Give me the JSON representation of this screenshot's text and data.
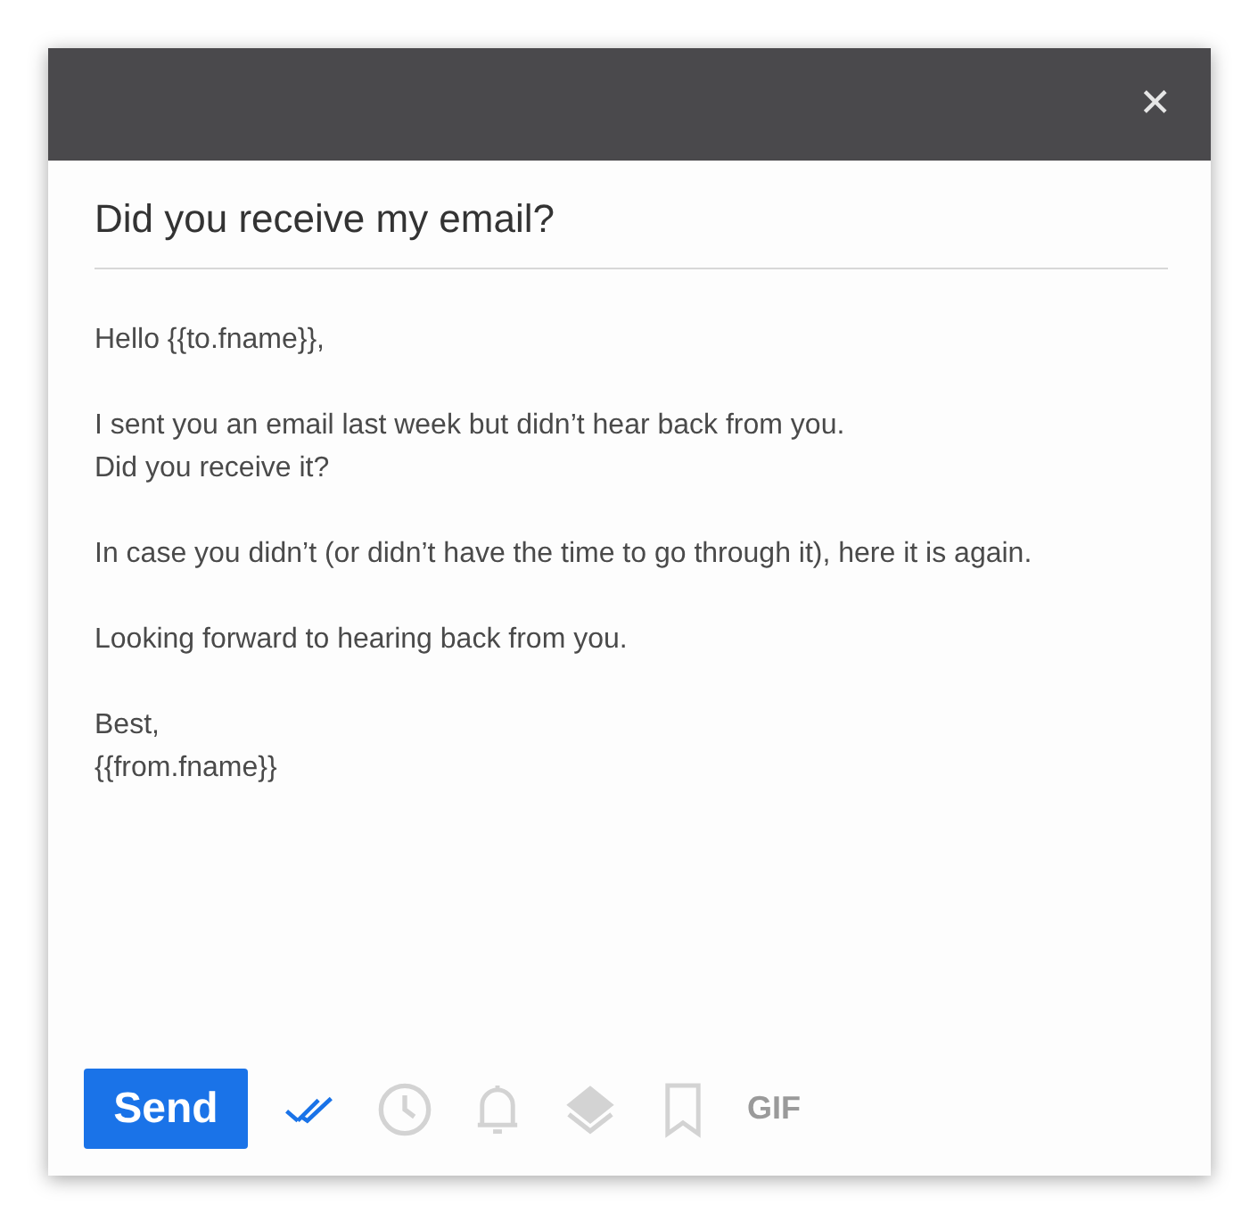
{
  "window": {
    "close": "✕"
  },
  "subject": "Did you receive my email?",
  "body": [
    [
      "Hello {{to.fname}},"
    ],
    [
      "I sent you an email last week but didn’t hear back from you.",
      "Did you receive it?"
    ],
    [
      "In case you didn’t (or didn’t have the time to go through it), here it is again."
    ],
    [
      "Looking forward to hearing back from you."
    ],
    [
      "Best,",
      "{{from.fname}}"
    ]
  ],
  "send": "Send",
  "tools": [
    {
      "kind": "double-check",
      "on": true
    },
    {
      "kind": "clock",
      "on": false
    },
    {
      "kind": "bell",
      "on": false
    },
    {
      "kind": "layers",
      "on": false
    },
    {
      "kind": "bookmark",
      "on": false
    },
    {
      "kind": "gif",
      "label": "GIF",
      "on": false
    }
  ]
}
